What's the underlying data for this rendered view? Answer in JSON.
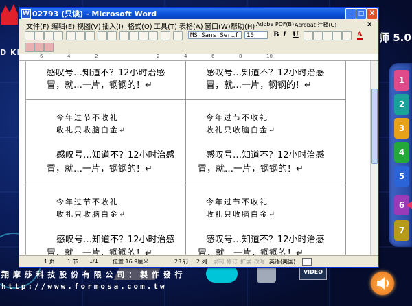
{
  "window": {
    "title": "02793 (只读) - Microsoft Word",
    "icon_letter": "W",
    "min_glyph": "_",
    "max_glyph": "□",
    "close_glyph": "X"
  },
  "menu": {
    "items": [
      "文件(F)",
      "编辑(E)",
      "视图(V)",
      "插入(I)",
      "格式(O)",
      "工具(T)",
      "表格(A)",
      "窗口(W)",
      "帮助(H)",
      "Adobe PDF(B)",
      "Acrobat 注释(C)"
    ],
    "close_glyph": "x"
  },
  "toolbar": {
    "font_name": "MS Sans Serif",
    "font_size": "10",
    "bold": "B",
    "italic": "I",
    "underline": "U",
    "font_color": "A"
  },
  "ruler": {
    "numbers": [
      "6",
      "4",
      "2",
      "2",
      "4",
      "6",
      "8",
      "10"
    ]
  },
  "document": {
    "top_text_left": "感叹号…知道不？12小时治感",
    "top_text_right": "感叹号…知道不？12小时治感",
    "top_line2": "冒，就…一片，钢钢的！↵",
    "poem_line1": "今年过节不收礼",
    "poem_line2": "收礼只收脑白金↵",
    "para_line1": "感叹号…知道不？12小时治感",
    "para_line2": "冒，就…一片，钢钢的！↵"
  },
  "status": {
    "page": "1 页",
    "section": "1 节",
    "pages": "1/1",
    "position": "位置 16.9厘米",
    "line": "23 行",
    "col": "2 列",
    "rec": "录制",
    "trk": "修订",
    "ext": "扩展",
    "ovr": "改写",
    "lang": "英语(美国)"
  },
  "background": {
    "right_title": "师 5.0",
    "left_logo_text": "D KI",
    "company": "翔 摩 莎 科 技 股 份 有 限 公 司  ：  製 作 發 行",
    "url": "http://www.formosa.com.tw",
    "video_label": "VIDEO"
  },
  "chapters": [
    {
      "label": "1",
      "color": "#e04a8a"
    },
    {
      "label": "2",
      "color": "#1aa29a"
    },
    {
      "label": "3",
      "color": "#e8a21a"
    },
    {
      "label": "4",
      "color": "#24a83a"
    },
    {
      "label": "5",
      "color": "#2a64d8"
    },
    {
      "label": "6",
      "color": "#9b3ab8"
    },
    {
      "label": "7",
      "color": "#b89a1a"
    }
  ]
}
